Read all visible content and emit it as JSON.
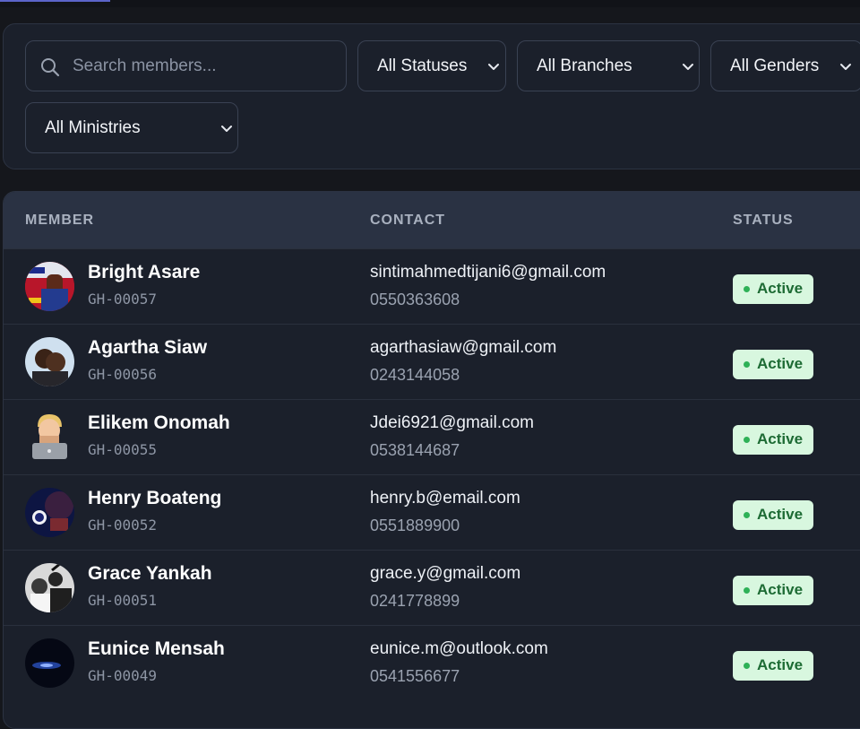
{
  "filters": {
    "search": {
      "placeholder": "Search members..."
    },
    "status": {
      "selected": "All Statuses"
    },
    "branch": {
      "selected": "All Branches"
    },
    "gender": {
      "selected": "All Genders"
    },
    "ministry": {
      "selected": "All Ministries"
    }
  },
  "table": {
    "headers": {
      "member": "MEMBER",
      "contact": "CONTACT",
      "status": "STATUS"
    },
    "rows": [
      {
        "name": "Bright Asare",
        "id": "GH-00057",
        "email": "sintimahmedtijani6@gmail.com",
        "phone": "0550363608",
        "status": "Active"
      },
      {
        "name": "Agartha Siaw",
        "id": "GH-00056",
        "email": "agarthasiaw@gmail.com",
        "phone": "0243144058",
        "status": "Active"
      },
      {
        "name": "Elikem Onomah",
        "id": "GH-00055",
        "email": "Jdei6921@gmail.com",
        "phone": "0538144687",
        "status": "Active"
      },
      {
        "name": "Henry Boateng",
        "id": "GH-00052",
        "email": "henry.b@email.com",
        "phone": "0551889900",
        "status": "Active"
      },
      {
        "name": "Grace Yankah",
        "id": "GH-00051",
        "email": "grace.y@gmail.com",
        "phone": "0241778899",
        "status": "Active"
      },
      {
        "name": "Eunice Mensah",
        "id": "GH-00049",
        "email": "eunice.m@outlook.com",
        "phone": "0541556677",
        "status": "Active"
      }
    ]
  },
  "colors": {
    "background": "#15171c",
    "panel": "#1b202b",
    "table_header": "#2a3243",
    "badge_bg": "#d8f7df",
    "badge_text": "#1d6b34",
    "badge_dot": "#2eb157"
  }
}
